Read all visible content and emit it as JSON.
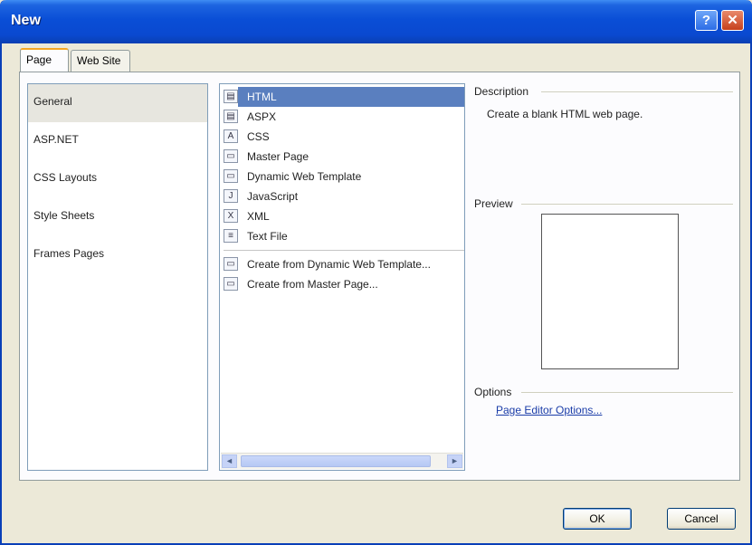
{
  "window": {
    "title": "New"
  },
  "titlebar_buttons": {
    "help": "?",
    "close": "✕"
  },
  "tabs": [
    {
      "label": "Page"
    },
    {
      "label": "Web Site"
    }
  ],
  "categories": [
    {
      "label": "General"
    },
    {
      "label": "ASP.NET"
    },
    {
      "label": "CSS Layouts"
    },
    {
      "label": "Style Sheets"
    },
    {
      "label": "Frames Pages"
    }
  ],
  "files": [
    {
      "label": "HTML",
      "icon": "html-file-icon",
      "glyph": "▤"
    },
    {
      "label": "ASPX",
      "icon": "aspx-file-icon",
      "glyph": "▤"
    },
    {
      "label": "CSS",
      "icon": "css-file-icon",
      "glyph": "A"
    },
    {
      "label": "Master Page",
      "icon": "master-page-icon",
      "glyph": "▭"
    },
    {
      "label": "Dynamic Web Template",
      "icon": "dwt-file-icon",
      "glyph": "▭"
    },
    {
      "label": "JavaScript",
      "icon": "javascript-file-icon",
      "glyph": "J"
    },
    {
      "label": "XML",
      "icon": "xml-file-icon",
      "glyph": "X"
    },
    {
      "label": "Text File",
      "icon": "text-file-icon",
      "glyph": "≡"
    }
  ],
  "files_extra": [
    {
      "label": "Create from Dynamic Web Template...",
      "icon": "dwt-create-icon",
      "glyph": "▭"
    },
    {
      "label": "Create from Master Page...",
      "icon": "master-create-icon",
      "glyph": "▭"
    }
  ],
  "scroll": {
    "left": "◄",
    "right": "►"
  },
  "description": {
    "label": "Description",
    "text": "Create a blank HTML web page."
  },
  "preview": {
    "label": "Preview"
  },
  "options": {
    "label": "Options",
    "link": "Page Editor Options..."
  },
  "buttons": {
    "ok": "OK",
    "cancel": "Cancel"
  }
}
